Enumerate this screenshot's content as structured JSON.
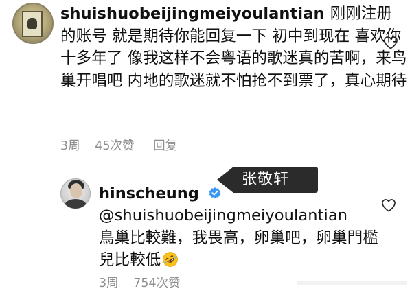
{
  "comments": [
    {
      "username": "shuishuobeijingmeiyoulantian",
      "body": "刚刚注册的账号 就是期待你能回复一下 初中到现在 喜欢你十多年了 像我这样不会粤语的歌迷真的苦啊，来鸟巢开唱吧 内地的歌迷就不怕抢不到票了，真心期待",
      "time": "3周",
      "likes": "45次赞",
      "reply": "回复"
    },
    {
      "username": "hinscheung",
      "verified": true,
      "mention": "@shuishuobeijingmeiyoulantian",
      "body": "鳥巢比較難，我畏高，卵巢吧，卵巢門檻兒比較低",
      "emoji": "rolling-on-floor-laughing",
      "time": "3周",
      "likes": "754次赞"
    }
  ],
  "overlay_label": "张敬轩",
  "icons": {
    "like": "heart-outline-icon",
    "verified": "verified-badge-icon"
  },
  "colors": {
    "text": "#111111",
    "meta": "#8e8e8e",
    "verified": "#3897f0",
    "label_bg": "#2b2b2b"
  }
}
